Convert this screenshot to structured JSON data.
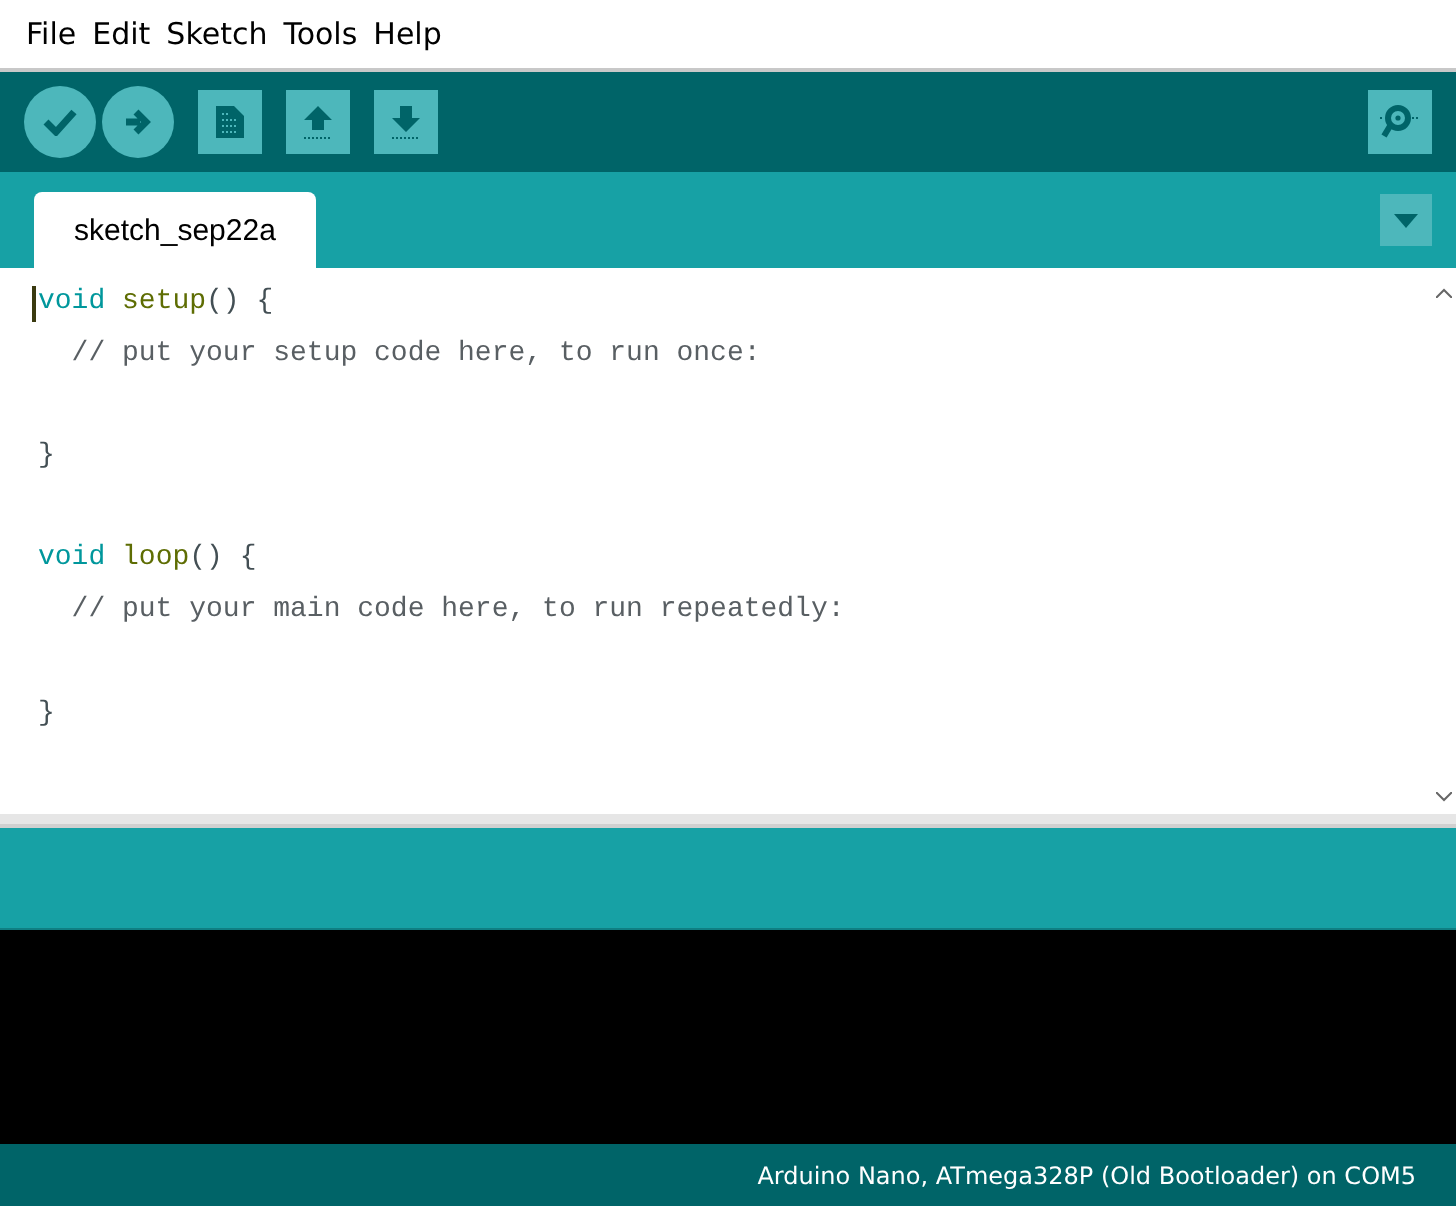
{
  "menu": [
    "File",
    "Edit",
    "Sketch",
    "Tools",
    "Help"
  ],
  "tabs": [
    {
      "label": "sketch_sep22a",
      "selected": true
    }
  ],
  "editor": {
    "lines": [
      {
        "kind": "code",
        "tokens": [
          {
            "kind": "keyword",
            "text": "void "
          },
          {
            "kind": "function",
            "text": "setup"
          },
          {
            "kind": "punct",
            "text": "() {"
          }
        ]
      },
      {
        "kind": "code",
        "tokens": [
          {
            "kind": "comment",
            "text": "  // put your setup code here, to run once:"
          }
        ]
      },
      {
        "kind": "blank"
      },
      {
        "kind": "code",
        "tokens": [
          {
            "kind": "punct",
            "text": "}"
          }
        ]
      },
      {
        "kind": "blank"
      },
      {
        "kind": "code",
        "tokens": [
          {
            "kind": "keyword",
            "text": "void "
          },
          {
            "kind": "function",
            "text": "loop"
          },
          {
            "kind": "punct",
            "text": "() {"
          }
        ]
      },
      {
        "kind": "code",
        "tokens": [
          {
            "kind": "comment",
            "text": "  // put your main code here, to run repeatedly:"
          }
        ]
      },
      {
        "kind": "blank"
      },
      {
        "kind": "code",
        "tokens": [
          {
            "kind": "punct",
            "text": "}"
          }
        ]
      }
    ]
  },
  "status_bar": {
    "board": "Arduino Nano, ATmega328P (Old Bootloader) on COM5"
  }
}
